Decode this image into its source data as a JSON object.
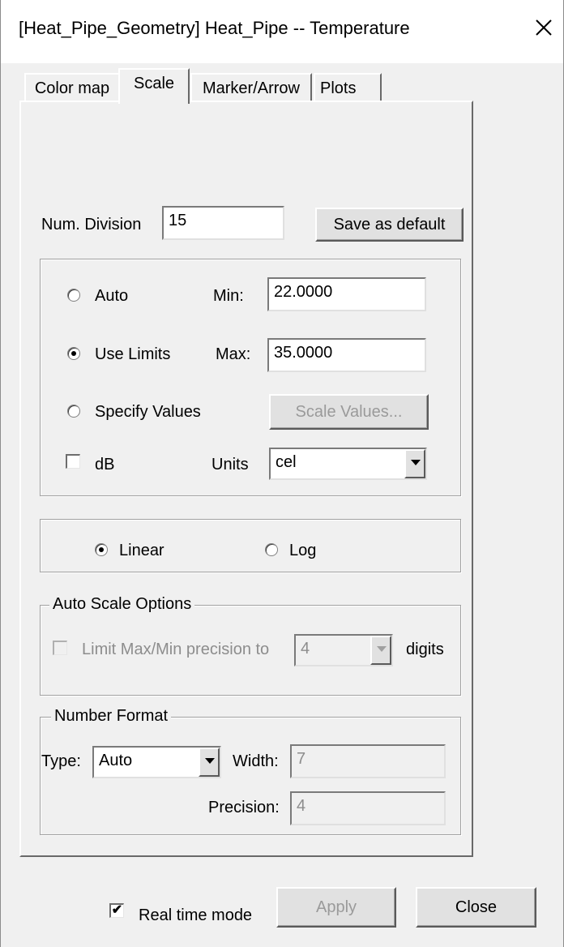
{
  "window": {
    "title": "[Heat_Pipe_Geometry] Heat_Pipe -- Temperature",
    "close_icon": "close-icon"
  },
  "tabs": [
    {
      "label": "Color map",
      "active": false
    },
    {
      "label": "Scale",
      "active": true
    },
    {
      "label": "Marker/Arrow",
      "active": false
    },
    {
      "label": "Plots",
      "active": false
    }
  ],
  "scale": {
    "num_division_label": "Num. Division",
    "num_division_value": "15",
    "save_default_label": "Save as default",
    "range": {
      "auto_label": "Auto",
      "use_limits_label": "Use Limits",
      "specify_values_label": "Specify Values",
      "selected": "use_limits",
      "min_label": "Min:",
      "min_value": "22.0000",
      "max_label": "Max:",
      "max_value": "35.0000",
      "scale_values_label": "Scale Values...",
      "db_label": "dB",
      "db_checked": false,
      "units_label": "Units",
      "units_value": "cel"
    },
    "spacing": {
      "linear_label": "Linear",
      "log_label": "Log",
      "selected": "linear"
    },
    "auto_scale": {
      "title": "Auto Scale Options",
      "limit_label": "Limit Max/Min precision to",
      "limit_checked": false,
      "digits_value": "4",
      "digits_label": "digits"
    },
    "number_format": {
      "title": "Number Format",
      "type_label": "Type:",
      "type_value": "Auto",
      "width_label": "Width:",
      "width_value": "7",
      "precision_label": "Precision:",
      "precision_value": "4"
    }
  },
  "footer": {
    "realtime_label": "Real time mode",
    "realtime_checked": true,
    "check_mark": "✔",
    "apply_label": "Apply",
    "close_label": "Close"
  }
}
